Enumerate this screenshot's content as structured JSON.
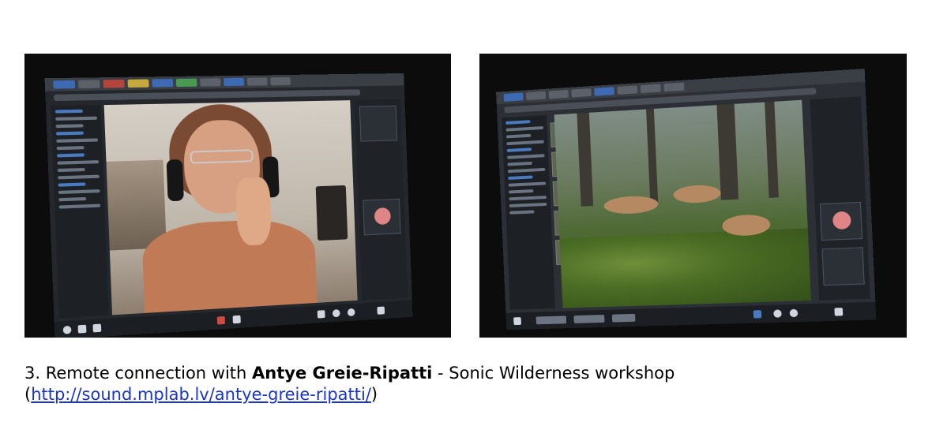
{
  "caption": {
    "prefix": "3. Remote connection with ",
    "name": "Antye Greie-Ripatti",
    "suffix": " - Sonic Wilderness workshop",
    "open_paren": "(",
    "link_text": "http://sound.mplab.lv/antye-greie-ripatti/",
    "close_paren": ")"
  },
  "colors": {
    "link": "#1a35cc",
    "text": "#000000",
    "photo_frame": "#0d0c0c"
  },
  "photos": [
    {
      "subject": "video call with woman wearing headphones"
    },
    {
      "subject": "forest floor with moss and mushrooms on video call screen"
    }
  ]
}
